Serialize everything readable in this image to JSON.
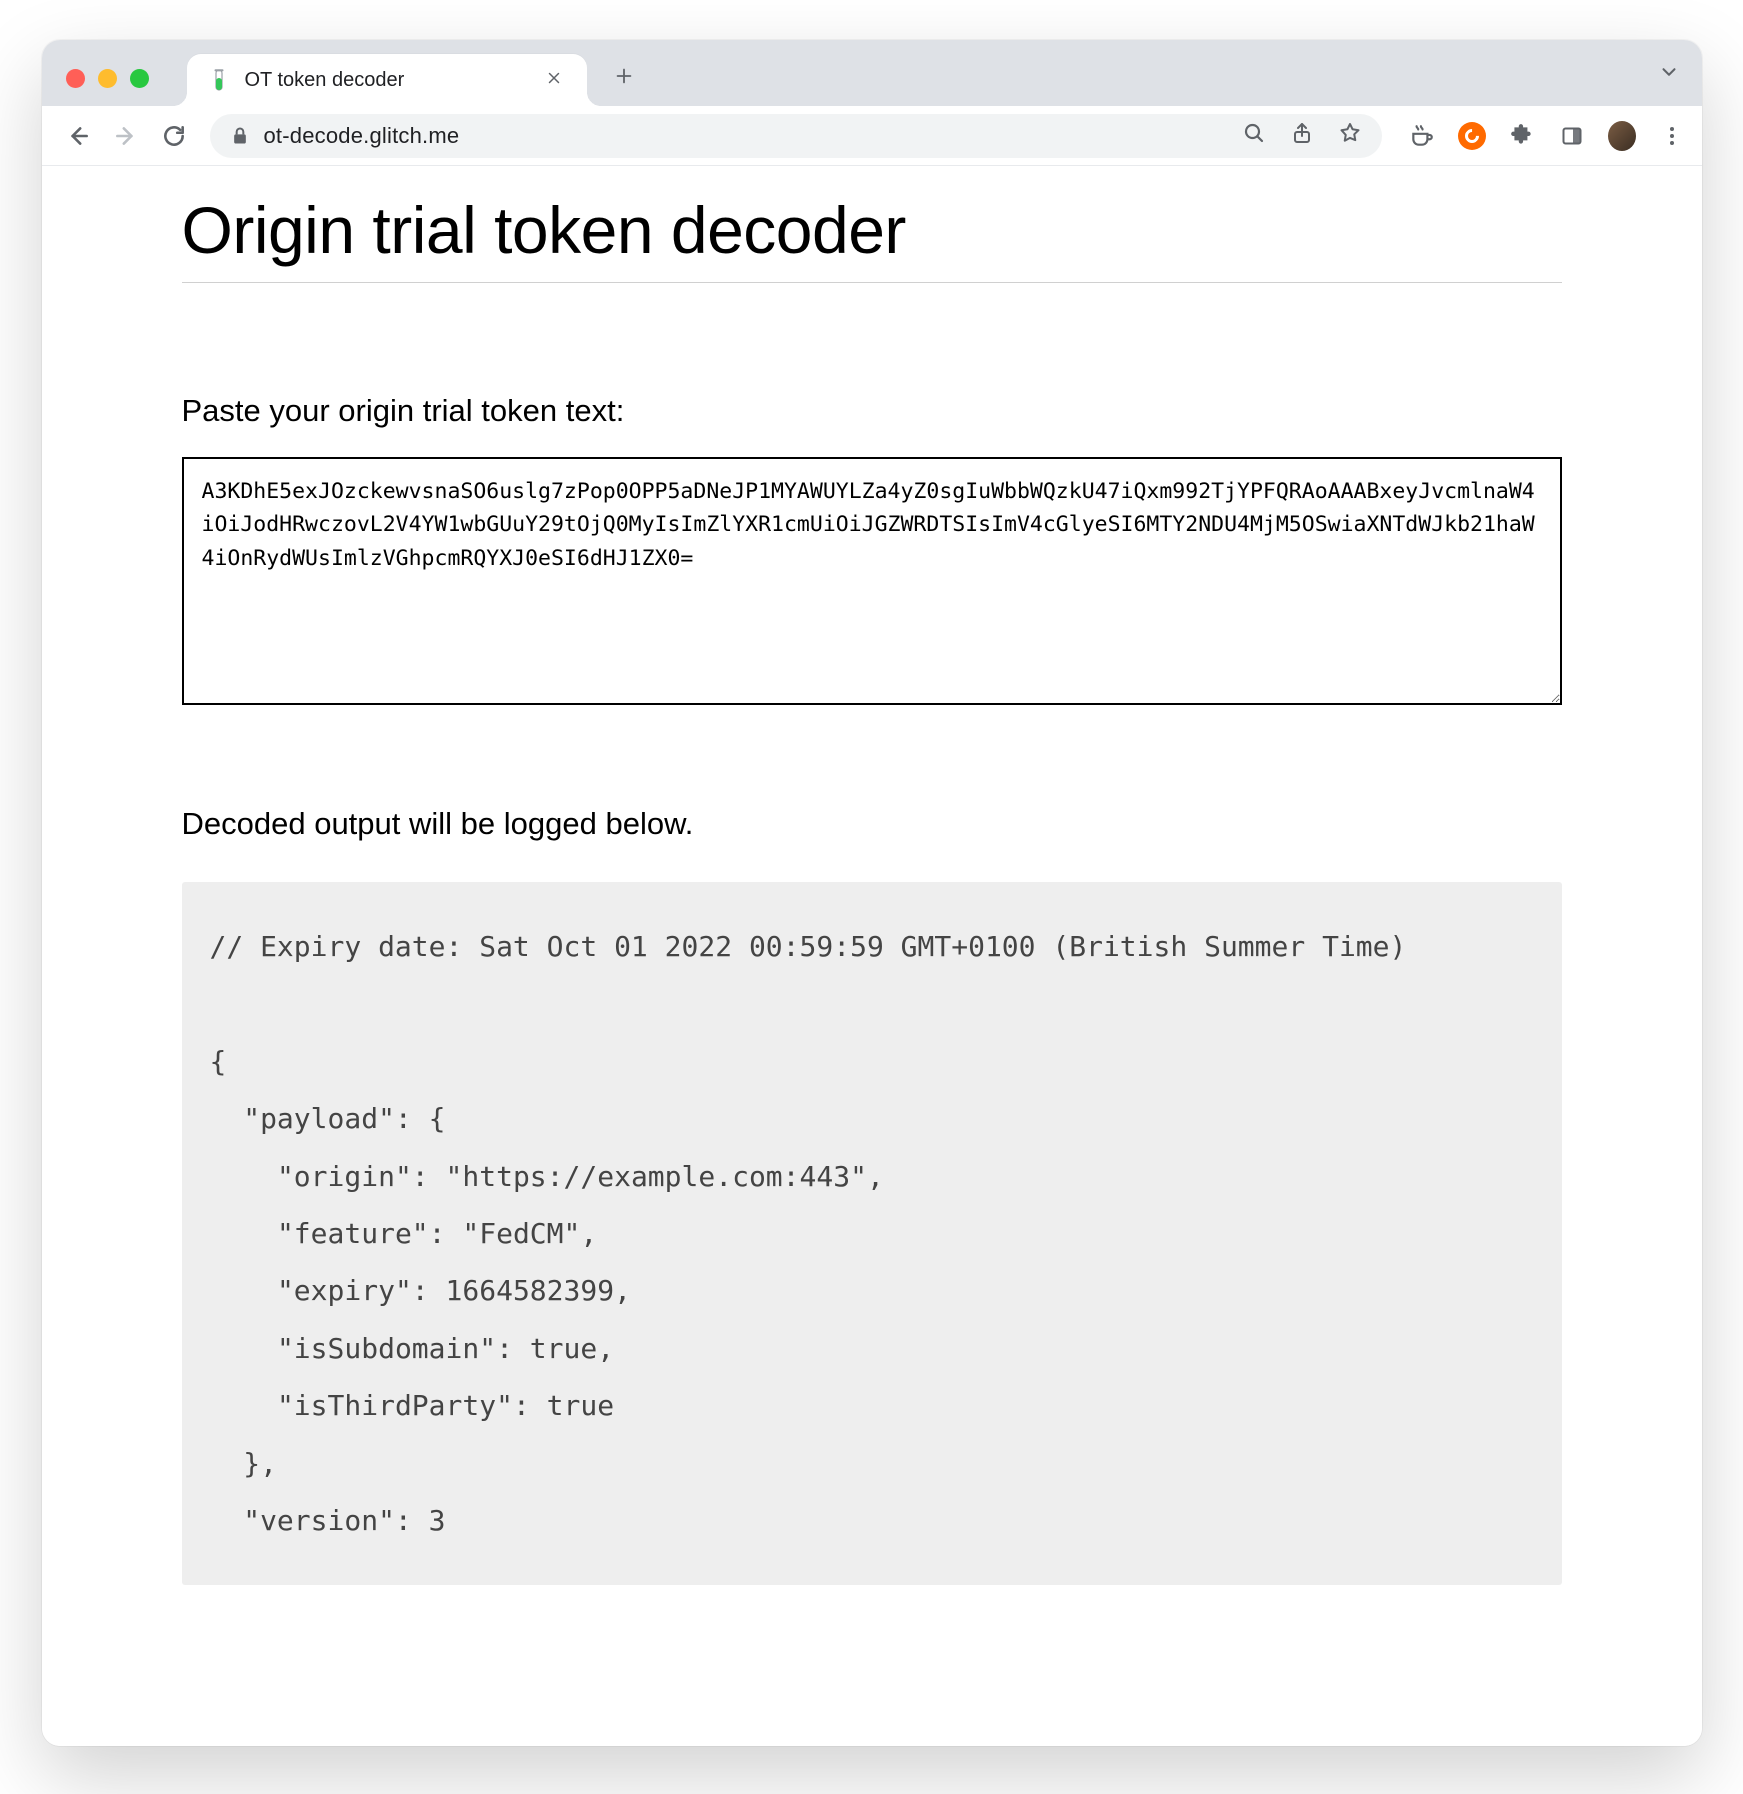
{
  "browser": {
    "tab": {
      "title": "OT token decoder"
    },
    "url": "ot-decode.glitch.me"
  },
  "page": {
    "title": "Origin trial token decoder",
    "paste_label": "Paste your origin trial token text:",
    "token_value": "A3KDhE5exJOzckewvsnaSO6uslg7zPop0OPP5aDNeJP1MYAWUYLZa4yZ0sgIuWbbWQzkU47iQxm992TjYPFQRAoAAABxeyJvcmlnaW4iOiJodHRwczovL2V4YW1wbGUuY29tOjQ0MyIsImZlYXR1cmUiOiJGZWRDTSIsImV4cGlyeSI6MTY2NDU4MjM5OSwiaXNTdWJkb21haW4iOnRydWUsImlzVGhpcmRQYXJ0eSI6dHJ1ZX0=",
    "output_label": "Decoded output will be logged below.",
    "decoded_comment": "// Expiry date: Sat Oct 01 2022 00:59:59 GMT+0100 (British Summer Time)",
    "decoded": {
      "payload": {
        "origin": "https://example.com:443",
        "feature": "FedCM",
        "expiry": 1664582399,
        "isSubdomain": true,
        "isThirdParty": true
      },
      "version": 3
    }
  }
}
